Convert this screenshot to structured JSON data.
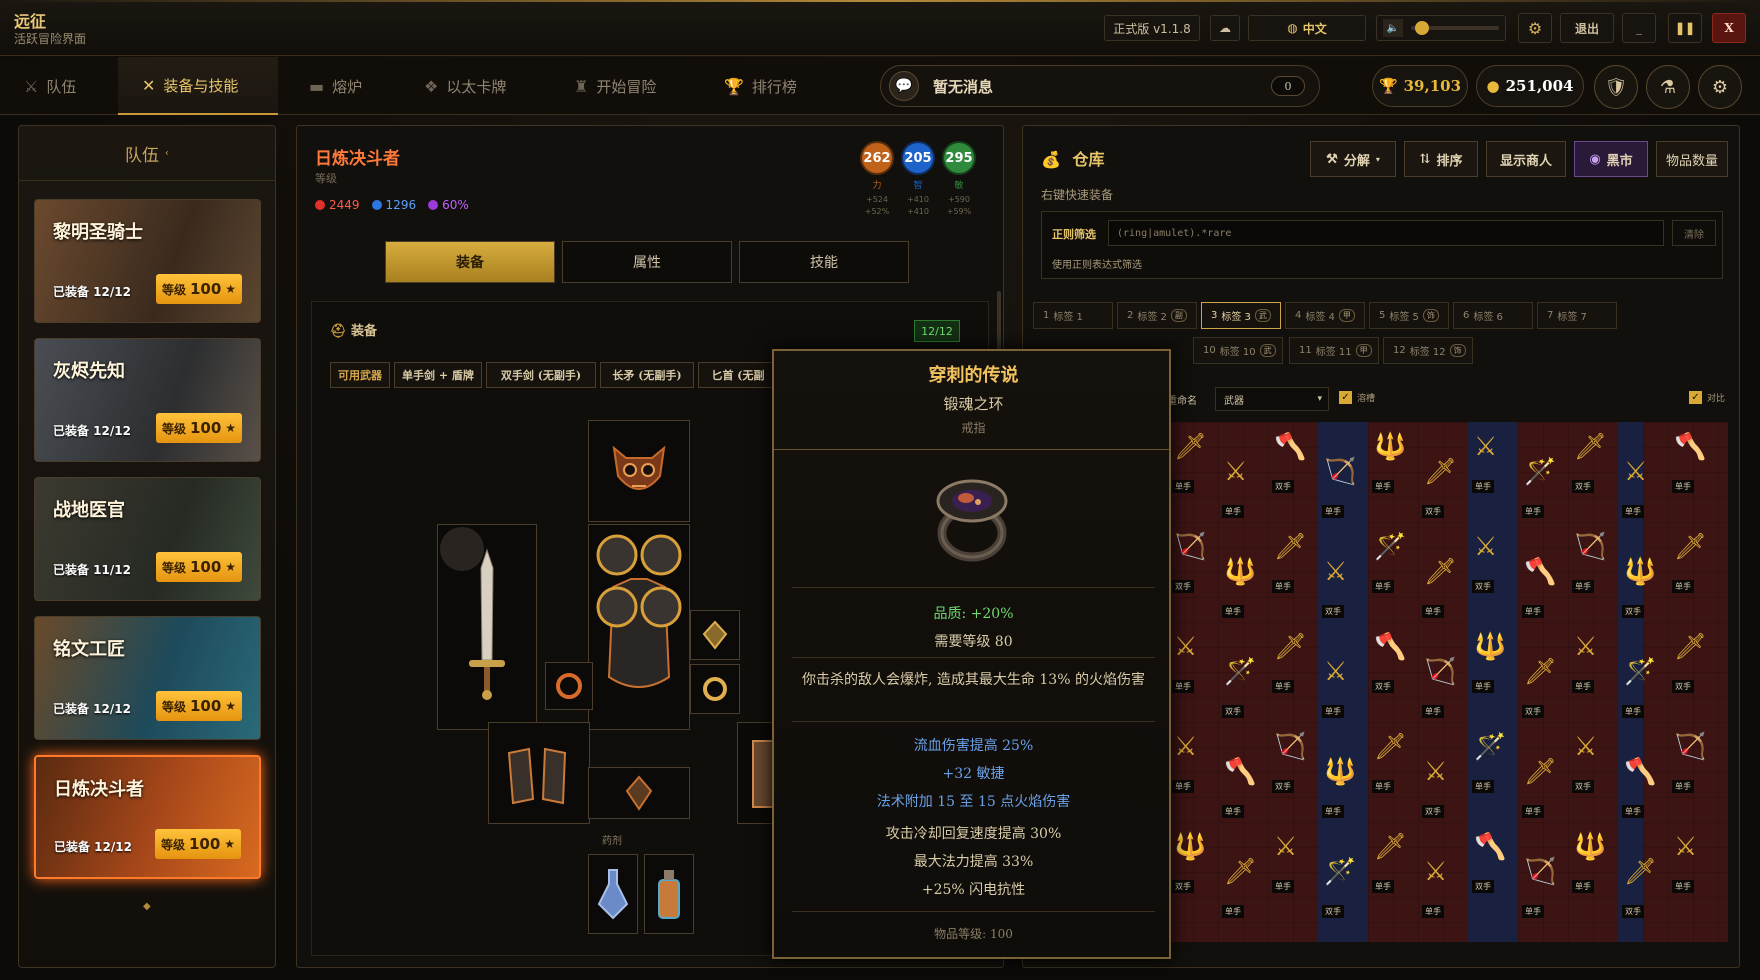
{
  "app": {
    "title": "远征",
    "subtitle": "活跃冒险界面"
  },
  "titlebar": {
    "version": "正式版 v1.1.8",
    "language": "中文",
    "exit": "退出",
    "volume": 0.05
  },
  "nav": {
    "tabs": [
      {
        "label": "队伍",
        "icon": "team-icon"
      },
      {
        "label": "装备与技能",
        "icon": "crossed-swords-icon",
        "active": true
      },
      {
        "label": "熔炉",
        "icon": "anvil-icon"
      },
      {
        "label": "以太卡牌",
        "icon": "card-icon"
      },
      {
        "label": "开始冒险",
        "icon": "castle-icon"
      },
      {
        "label": "排行榜",
        "icon": "trophy-icon"
      }
    ],
    "messages": {
      "text": "暂无消息",
      "count": "0"
    },
    "trophies": "39,103",
    "gold": "251,004"
  },
  "team": {
    "title": "队伍",
    "level_label": "等级",
    "members": [
      {
        "name": "黎明圣骑士",
        "equipped": "已装备 12/12",
        "level": "100"
      },
      {
        "name": "灰烬先知",
        "equipped": "已装备 12/12",
        "level": "100"
      },
      {
        "name": "战地医官",
        "equipped": "已装备 11/12",
        "level": "100"
      },
      {
        "name": "铭文工匠",
        "equipped": "已装备 12/12",
        "level": "100"
      },
      {
        "name": "日炼决斗者",
        "equipped": "已装备 12/12",
        "level": "100",
        "active": true
      }
    ]
  },
  "character": {
    "name": "日炼决斗者",
    "level_label": "等级",
    "life": "2449",
    "mana": "1296",
    "percent": "60%",
    "attributes": [
      {
        "value": "262",
        "label": "力",
        "bonus1": "+524",
        "bonus2": "+52%",
        "color": "#c0621a"
      },
      {
        "value": "205",
        "label": "智",
        "bonus1": "+410",
        "bonus2": "+410",
        "color": "#1e63c9"
      },
      {
        "value": "295",
        "label": "敏",
        "bonus1": "+590",
        "bonus2": "+59%",
        "color": "#2f8a3c"
      }
    ],
    "tabs": [
      "装备",
      "属性",
      "技能"
    ],
    "equip_title": "装备",
    "equip_count": "12/12",
    "weapon_label": "可用武器",
    "weapon_types": [
      "单手剑 + 盾牌",
      "双手剑 (无副手)",
      "长矛 (无副手)",
      "匕首 (无副"
    ],
    "potion_label": "药剂"
  },
  "warehouse": {
    "title": "仓库",
    "hint": "右键快速装备",
    "buttons": {
      "salvage": "分解",
      "sort": "排序",
      "merchant": "显示商人",
      "blackmarket": "黑市",
      "count": "物品数量"
    },
    "regex_label": "正则筛选",
    "regex_value": "(ring|amulet).*rare",
    "regex_clear": "清除",
    "regex_help": "使用正则表达式筛选",
    "tabs": [
      {
        "num": "1",
        "label": "标签 1",
        "badge": ""
      },
      {
        "num": "2",
        "label": "标签 2",
        "badge": "副"
      },
      {
        "num": "3",
        "label": "标签 3",
        "badge": "武",
        "active": true
      },
      {
        "num": "4",
        "label": "标签 4",
        "badge": "甲"
      },
      {
        "num": "5",
        "label": "标签 5",
        "badge": "饰"
      },
      {
        "num": "6",
        "label": "标签 6",
        "badge": ""
      },
      {
        "num": "7",
        "label": "标签 7",
        "badge": ""
      },
      {
        "num": "10",
        "label": "标签 10",
        "badge": "武"
      },
      {
        "num": "11",
        "label": "标签 11",
        "badge": "甲"
      },
      {
        "num": "12",
        "label": "标签 12",
        "badge": "饰"
      }
    ],
    "rename_label": "重命名",
    "filter_select": "武器",
    "check1": "溶槽",
    "check2": "对比",
    "hand1": "单手",
    "hand2": "双手"
  },
  "tooltip": {
    "name": "穿刺的传说",
    "base": "锻魂之环",
    "type": "戒指",
    "quality": "品质: +20%",
    "required_level": "需要等级 80",
    "implicit": "你击杀的敌人会爆炸, 造成其最大生命 13% 的火焰伤害",
    "magic_mods": [
      "流血伤害提高 25%",
      "+32 敏捷",
      "法术附加 15 至 15 点火焰伤害"
    ],
    "normal_mods": [
      "攻击冷却回复速度提高 30%",
      "最大法力提高 33%",
      "+25% 闪电抗性"
    ],
    "item_level": "物品等级: 100"
  }
}
